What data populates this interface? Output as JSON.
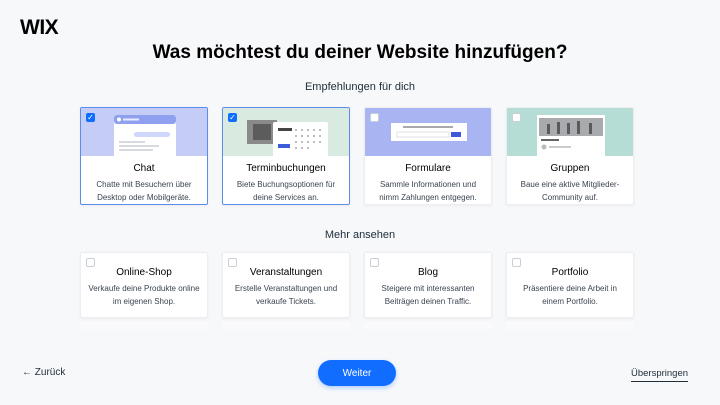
{
  "brand": {
    "logo": "WIX"
  },
  "page": {
    "title": "Was möchtest du deiner Website hinzufügen?"
  },
  "recommended": {
    "heading": "Empfehlungen für dich",
    "cards": [
      {
        "title": "Chat",
        "desc": "Chatte mit Besuchern über Desktop oder Mobilgeräte.",
        "selected": true,
        "thumb_color": "#c5cdf7"
      },
      {
        "title": "Terminbuchungen",
        "desc": "Biete Buchungsoptionen für deine Services an.",
        "selected": true,
        "thumb_color": "#d9ebe1"
      },
      {
        "title": "Formulare",
        "desc": "Sammle Informationen und nimm Zahlungen entgegen.",
        "selected": false,
        "thumb_color": "#a9b4f3"
      },
      {
        "title": "Gruppen",
        "desc": "Baue eine aktive Mitglieder-Community auf.",
        "selected": false,
        "thumb_color": "#b6ddd5"
      }
    ]
  },
  "more": {
    "heading": "Mehr ansehen",
    "cards": [
      {
        "title": "Online-Shop",
        "desc": "Verkaufe deine Produkte online im eigenen Shop.",
        "selected": false
      },
      {
        "title": "Veranstaltungen",
        "desc": "Erstelle Veranstaltungen und verkaufe Tickets.",
        "selected": false
      },
      {
        "title": "Blog",
        "desc": "Steigere mit interessanten Beiträgen deinen Traffic.",
        "selected": false
      },
      {
        "title": "Portfolio",
        "desc": "Präsentiere deine Arbeit in einem Portfolio.",
        "selected": false
      }
    ]
  },
  "footer": {
    "back_label": "← Zurück",
    "next_label": "Weiter",
    "skip_label": "Überspringen"
  },
  "colors": {
    "accent": "#116dff",
    "selected_border": "#5b8cf0"
  }
}
